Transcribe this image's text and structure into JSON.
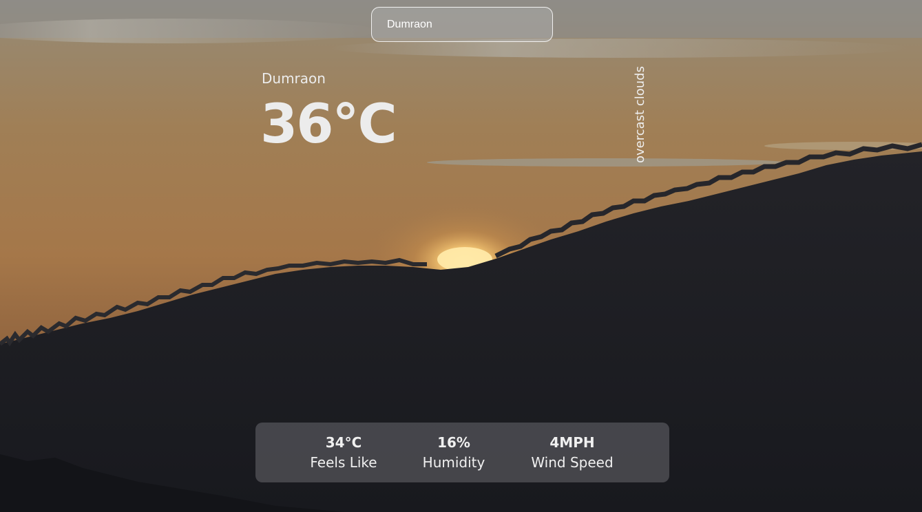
{
  "search": {
    "value": "Dumraon"
  },
  "weather": {
    "location": "Dumraon",
    "temperature": "36°C",
    "description": "overcast clouds"
  },
  "stats": {
    "feels_like": {
      "value": "34°C",
      "label": "Feels Like"
    },
    "humidity": {
      "value": "16%",
      "label": "Humidity"
    },
    "wind_speed": {
      "value": "4MPH",
      "label": "Wind Speed"
    }
  }
}
